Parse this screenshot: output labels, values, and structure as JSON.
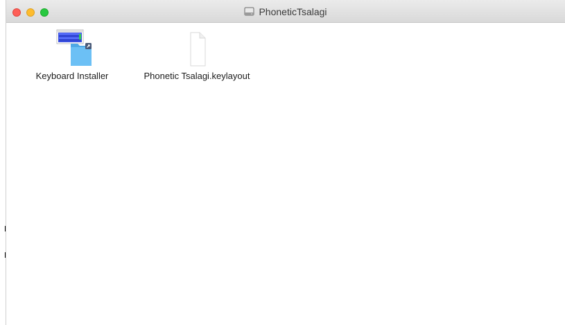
{
  "window": {
    "title": "PhoneticTsalagi"
  },
  "files": [
    {
      "name": "Keyboard Installer",
      "icon": "installer-folder-icon"
    },
    {
      "name": "Phonetic Tsalagi.keylayout",
      "icon": "document-icon"
    }
  ],
  "colors": {
    "close": "#fe5f57",
    "minimize": "#febc2e",
    "zoom": "#28c840",
    "folder": "#62b8f1"
  }
}
